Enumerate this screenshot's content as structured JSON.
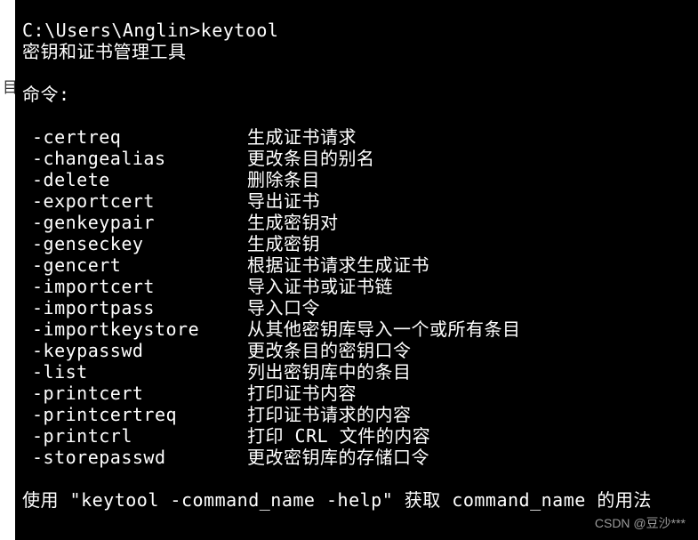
{
  "gutter": "目",
  "prompt": "C:\\Users\\Anglin>",
  "command": "keytool",
  "tool_desc": "密钥和证书管理工具",
  "commands_header": "命令:",
  "commands": [
    {
      "name": "-certreq",
      "desc": "生成证书请求"
    },
    {
      "name": "-changealias",
      "desc": "更改条目的别名"
    },
    {
      "name": "-delete",
      "desc": "删除条目"
    },
    {
      "name": "-exportcert",
      "desc": "导出证书"
    },
    {
      "name": "-genkeypair",
      "desc": "生成密钥对"
    },
    {
      "name": "-genseckey",
      "desc": "生成密钥"
    },
    {
      "name": "-gencert",
      "desc": "根据证书请求生成证书"
    },
    {
      "name": "-importcert",
      "desc": "导入证书或证书链"
    },
    {
      "name": "-importpass",
      "desc": "导入口令"
    },
    {
      "name": "-importkeystore",
      "desc": "从其他密钥库导入一个或所有条目"
    },
    {
      "name": "-keypasswd",
      "desc": "更改条目的密钥口令"
    },
    {
      "name": "-list",
      "desc": "列出密钥库中的条目"
    },
    {
      "name": "-printcert",
      "desc": "打印证书内容"
    },
    {
      "name": "-printcertreq",
      "desc": "打印证书请求的内容"
    },
    {
      "name": "-printcrl",
      "desc": "打印 CRL 文件的内容"
    },
    {
      "name": "-storepasswd",
      "desc": "更改密钥库的存储口令"
    }
  ],
  "usage_hint": "使用 \"keytool -command_name -help\" 获取 command_name 的用法",
  "watermark": "CSDN @豆沙***"
}
